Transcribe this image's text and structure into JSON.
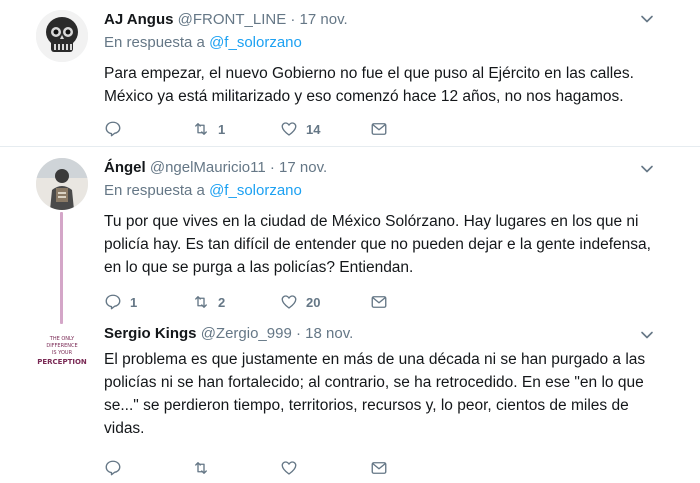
{
  "tweets": [
    {
      "name": "AJ Angus",
      "handle": "@FRONT_LINE",
      "separator": "·",
      "time": "17 nov.",
      "reply_prefix": "En respuesta a",
      "reply_to": "@f_solorzano",
      "lines": [
        "Para empezar, el nuevo Gobierno no fue el que puso al Ejército en las calles.",
        "México ya está militarizado y eso comenzó hace 12 años, no nos hagamos."
      ],
      "replies": "",
      "retweets": "1",
      "likes": "14"
    },
    {
      "name": "Ángel",
      "handle": "@ngelMauricio11",
      "separator": "·",
      "time": "17 nov.",
      "reply_prefix": "En respuesta a",
      "reply_to": "@f_solorzano",
      "lines": [
        "Tu por que vives en la ciudad de México Solórzano. Hay lugares en los que ni",
        "policía hay. Es tan difícil de entender que no pueden dejar e la gente indefensa,",
        "en lo que se purga a las policías? Entiendan."
      ],
      "replies": "1",
      "retweets": "2",
      "likes": "20"
    },
    {
      "name": "Sergio Kings",
      "handle": "@Zergio_999",
      "separator": "·",
      "time": "18 nov.",
      "lines": [
        "El problema es que justamente en más de una década ni se han purgado a las",
        "policías ni se han fortalecido; al contrario, se ha retrocedido. En ese \"en lo que",
        "se...\" se perdieron tiempo, territorios, recursos y, lo peor, cientos de miles de",
        "vidas."
      ],
      "avatar_text": [
        "THE ONLY",
        "DIFFERENCE",
        "IS YOUR",
        "PERCEPTION"
      ],
      "replies": "",
      "retweets": "",
      "likes": ""
    }
  ],
  "icons": [
    "reply-icon",
    "retweet-icon",
    "like-icon",
    "message-icon",
    "chevron-down-icon"
  ],
  "colors": {
    "link": "#1da1f2",
    "muted": "#657786",
    "text": "#14171a",
    "thread": "#d4a6c8",
    "divider": "#e6ecf0"
  }
}
